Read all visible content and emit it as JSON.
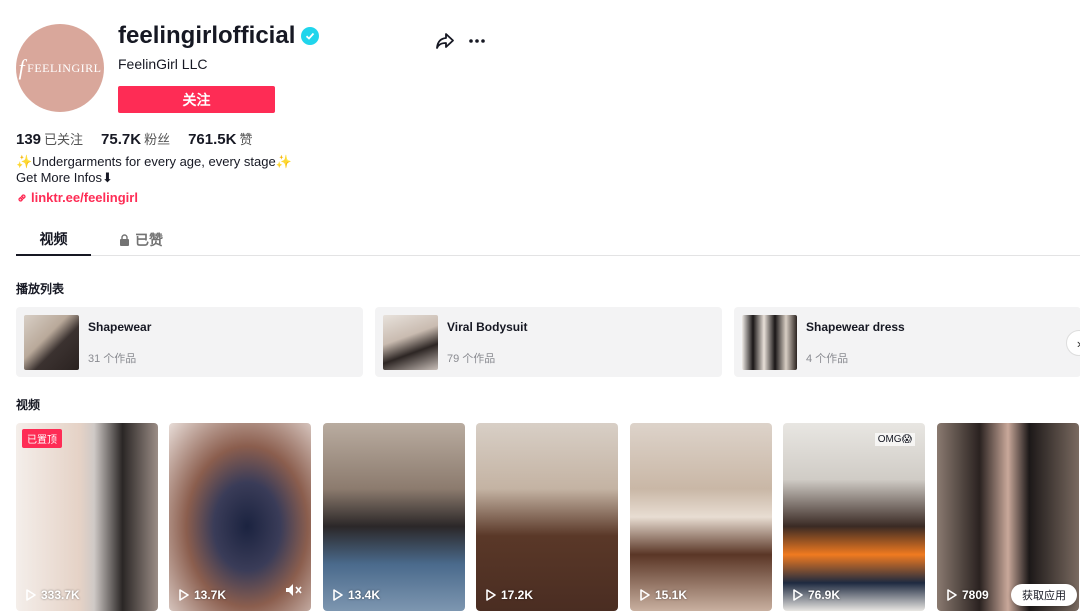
{
  "profile": {
    "avatar_text": "FEELINGIRL",
    "username": "feelingirlofficial",
    "nickname": "FeelinGirl LLC",
    "follow_label": "关注"
  },
  "stats": [
    {
      "num": "139",
      "label": "已关注"
    },
    {
      "num": "75.7K",
      "label": "粉丝"
    },
    {
      "num": "761.5K",
      "label": "赞"
    }
  ],
  "bio": {
    "line1": "✨Undergarments for every age, every stage✨",
    "line2": "Get More Infos⬇",
    "link": "linktr.ee/feelingirl"
  },
  "tabs": {
    "videos": "视频",
    "liked": "已赞"
  },
  "playlists_title": "播放列表",
  "playlists": [
    {
      "name": "Shapewear",
      "count": "31 个作品"
    },
    {
      "name": "Viral Bodysuit",
      "count": "79 个作品"
    },
    {
      "name": "Shapewear dress",
      "count": "4 个作品"
    }
  ],
  "videos_title": "视频",
  "videos": [
    {
      "views": "333.7K",
      "badge": "已置顶"
    },
    {
      "views": "13.7K"
    },
    {
      "views": "13.4K"
    },
    {
      "views": "17.2K"
    },
    {
      "views": "15.1K"
    },
    {
      "views": "76.9K",
      "overlay": "OMG😱"
    },
    {
      "views": "7809"
    }
  ],
  "get_app": "获取应用",
  "colors": {
    "accent": "#fe2c55",
    "verified": "#20d5ec"
  }
}
